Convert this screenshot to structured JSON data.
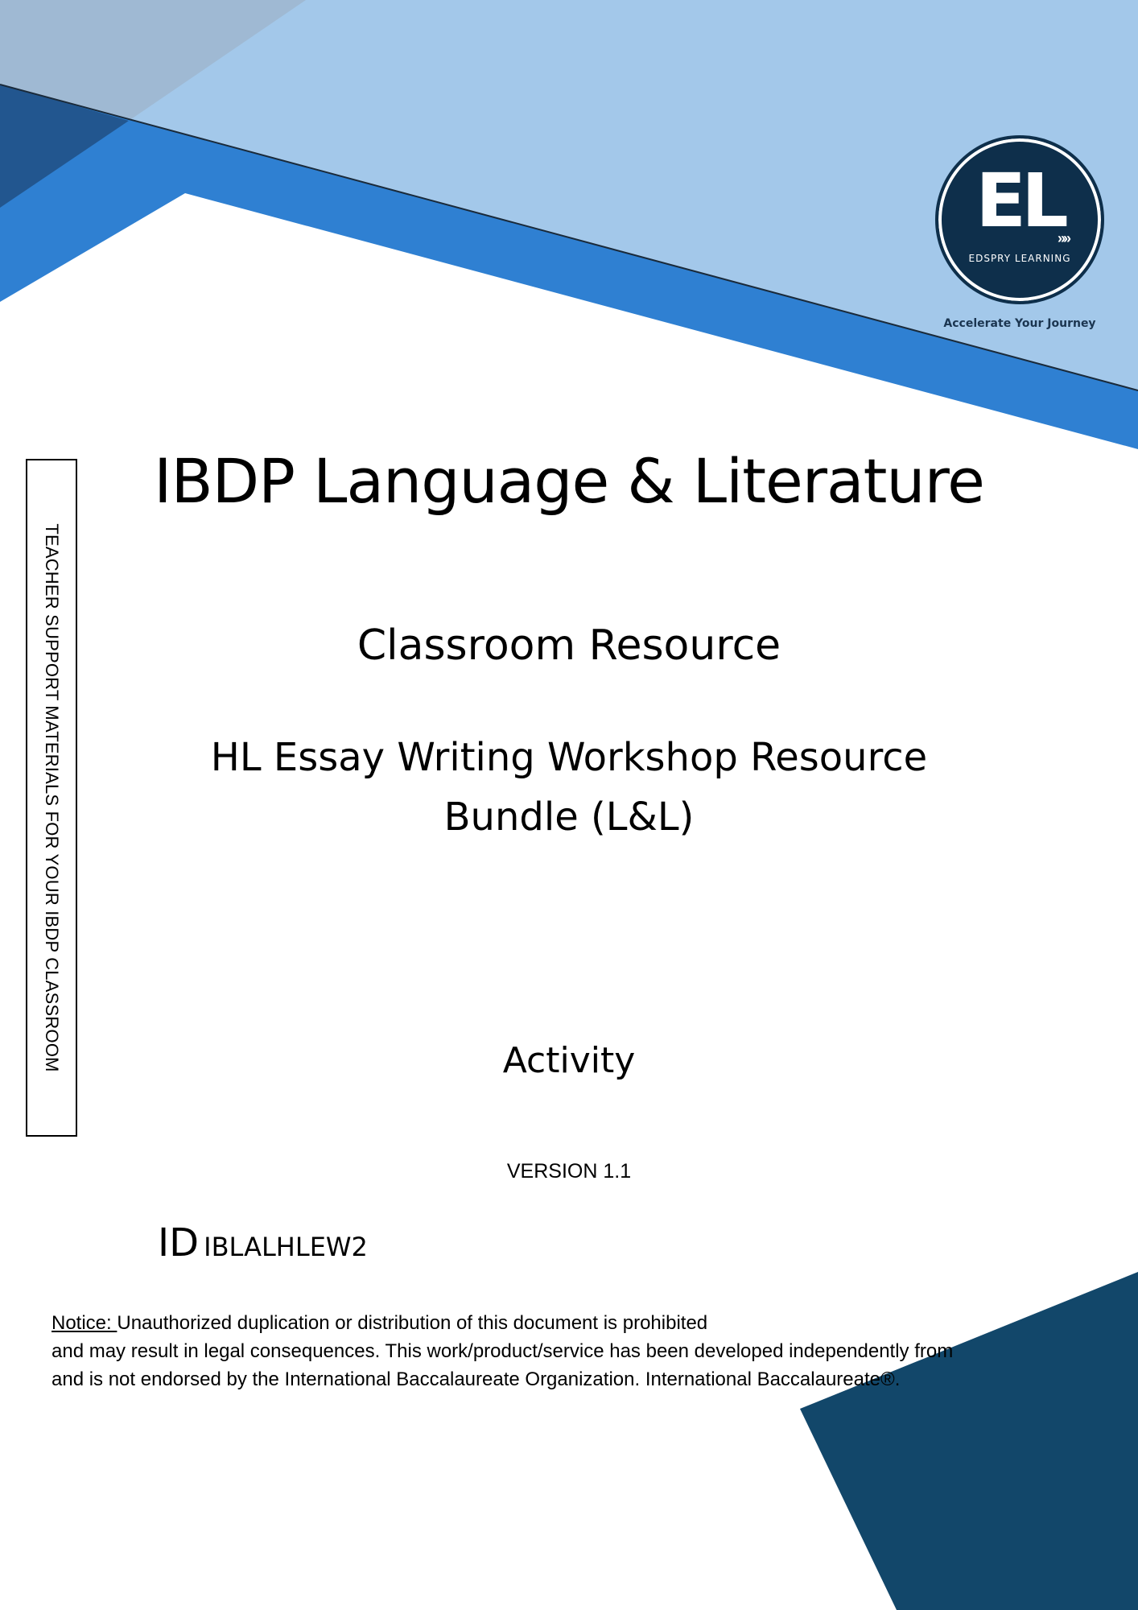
{
  "brand": {
    "logo_text": "EL",
    "logo_name": "EDSPRY LEARNING",
    "tagline": "Accelerate Your Journey"
  },
  "side_label": "TEACHER SUPPORT MATERIALS FOR YOUR IBDP CLASSROOM",
  "title": "IBDP Language & Literature",
  "subtitle": "Classroom Resource",
  "resource": {
    "line1": "HL Essay Writing Workshop Resource",
    "line2": "Bundle (L&L)"
  },
  "activity": "Activity",
  "version": "VERSION 1.1",
  "id": {
    "prefix": "ID",
    "code": "IBLALHLEW2"
  },
  "notice": {
    "label": "Notice: ",
    "line1": "Unauthorized duplication or distribution of this document is prohibited",
    "line2": "and may result in legal consequences. This work/product/service has been developed independently from",
    "line3": "and is not endorsed by the International Baccalaureate Organization. International  Baccalaureate®."
  },
  "colors": {
    "light_blue": "#a3c8ea",
    "mid_blue": "#2f80d2",
    "dark_blue": "#22568f",
    "navy": "#12476a",
    "logo_navy": "#0e2f4b"
  }
}
